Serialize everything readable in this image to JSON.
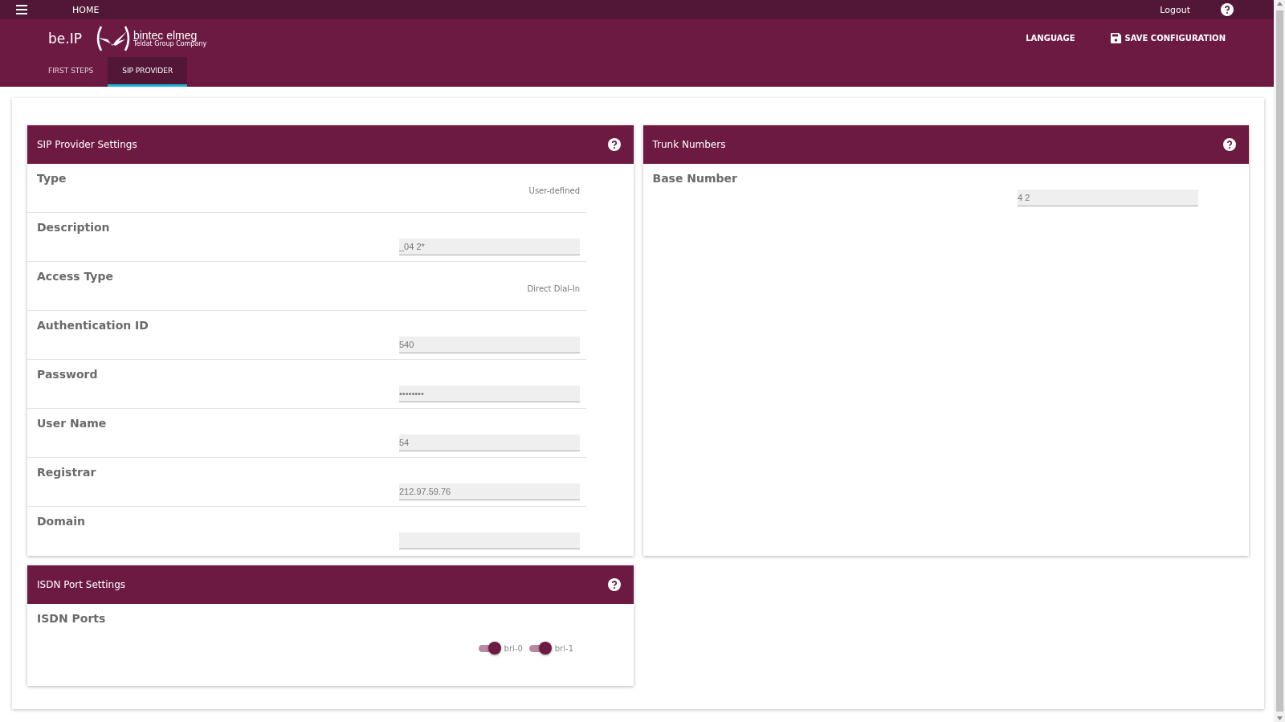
{
  "topbar": {
    "home": "HOME",
    "logout": "Logout"
  },
  "header": {
    "brand": "be.IP",
    "logo_name": "bintec elmeg",
    "logo_sub": "Teldat Group Company",
    "language": "LANGUAGE",
    "save": "SAVE CONFIGURATION"
  },
  "tabs": [
    {
      "label": "FIRST STEPS",
      "selected": false
    },
    {
      "label": "SIP PROVIDER",
      "selected": true
    }
  ],
  "sip_panel": {
    "title": "SIP Provider Settings",
    "rows": [
      {
        "label": "Type",
        "kind": "text",
        "value": "User-defined"
      },
      {
        "label": "Description",
        "kind": "input",
        "value": "_04 2*"
      },
      {
        "label": "Access Type",
        "kind": "text",
        "value": "Direct Dial-In"
      },
      {
        "label": "Authentication ID",
        "kind": "input",
        "value": "540"
      },
      {
        "label": "Password",
        "kind": "input",
        "value": "••••••••"
      },
      {
        "label": "User Name",
        "kind": "input",
        "value": "54"
      },
      {
        "label": "Registrar",
        "kind": "input",
        "value": "212.97.59.76"
      },
      {
        "label": "Domain",
        "kind": "input",
        "value": ""
      }
    ]
  },
  "trunk_panel": {
    "title": "Trunk Numbers",
    "rows": [
      {
        "label": "Base Number",
        "kind": "input",
        "value": "4 2"
      }
    ]
  },
  "isdn_panel": {
    "title": "ISDN Port Settings",
    "label": "ISDN Ports",
    "ports": [
      {
        "label": "bri-0",
        "on": true
      },
      {
        "label": "bri-1",
        "on": true
      }
    ]
  }
}
